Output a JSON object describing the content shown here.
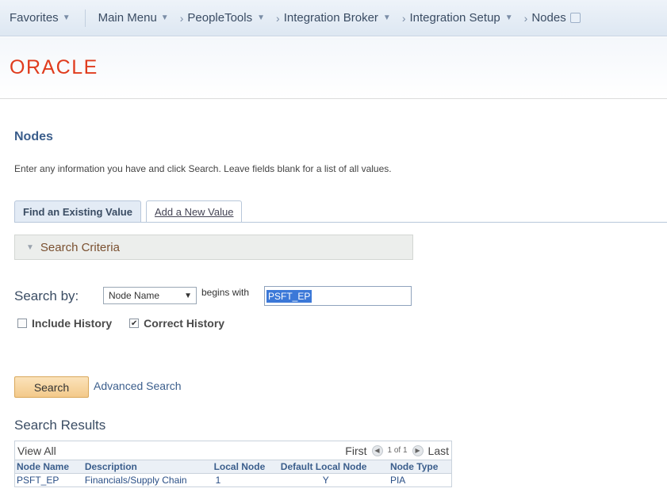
{
  "nav": {
    "favorites": "Favorites",
    "main_menu": "Main Menu",
    "breadcrumbs": [
      "PeopleTools",
      "Integration Broker",
      "Integration Setup",
      "Nodes"
    ]
  },
  "logo": "ORACLE",
  "page": {
    "title": "Nodes",
    "instructions": "Enter any information you have and click Search. Leave fields blank for a list of all values."
  },
  "tabs": {
    "find": "Find an Existing Value",
    "add": "Add a New Value"
  },
  "criteria": {
    "label": "Search Criteria",
    "search_by_label": "Search by:",
    "field_selected": "Node Name",
    "operator": "begins with",
    "value": "PSFT_EP",
    "include_history": {
      "label": "Include History",
      "checked": false
    },
    "correct_history": {
      "label": "Correct History",
      "checked": true
    }
  },
  "buttons": {
    "search": "Search",
    "advanced_search": "Advanced Search"
  },
  "results": {
    "title": "Search Results",
    "view_all": "View All",
    "first": "First",
    "page_count": "1 of 1",
    "last": "Last",
    "columns": [
      "Node Name",
      "Description",
      "Local Node",
      "Default Local Node",
      "Node Type"
    ],
    "rows": [
      [
        "PSFT_EP",
        "Financials/Supply Chain",
        "1",
        "Y",
        "PIA"
      ]
    ]
  }
}
